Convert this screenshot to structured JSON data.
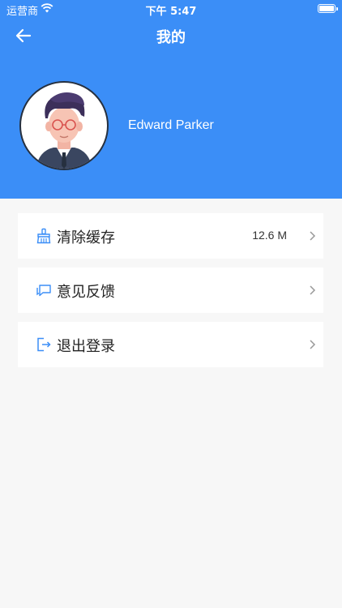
{
  "status_bar": {
    "carrier": "运营商",
    "time": "下午 5:47"
  },
  "nav": {
    "title": "我的"
  },
  "profile": {
    "name": "Edward Parker"
  },
  "menu": [
    {
      "label": "清除缓存",
      "value": "12.6 M",
      "icon": "broom-icon"
    },
    {
      "label": "意见反馈",
      "icon": "chat-bubble-icon"
    },
    {
      "label": "退出登录",
      "icon": "logout-icon"
    }
  ],
  "colors": {
    "primary": "#3b8ef7",
    "background": "#f7f7f7",
    "card": "#ffffff",
    "icon": "#3b8ef7"
  }
}
